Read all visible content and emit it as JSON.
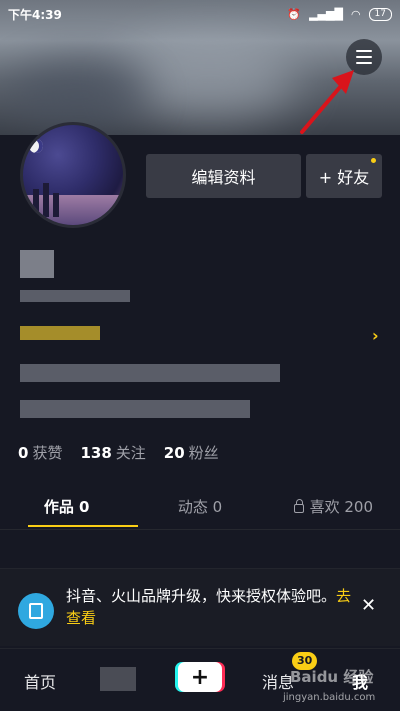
{
  "status_bar": {
    "time": "下午4:39",
    "battery": "17"
  },
  "profile": {
    "edit_button": "编辑资料",
    "add_friend_button": "+ 好友",
    "stats": [
      {
        "value": "0",
        "label": "获赞"
      },
      {
        "value": "138",
        "label": "关注"
      },
      {
        "value": "20",
        "label": "粉丝"
      }
    ]
  },
  "tabs": [
    {
      "label": "作品 0",
      "active": true
    },
    {
      "label": "动态 0",
      "active": false
    },
    {
      "label": "喜欢 200",
      "active": false,
      "icon": "lock-icon"
    }
  ],
  "notice": {
    "text": "抖音、火山品牌升级，快来授权体验吧。",
    "link": "去查看",
    "close": "✕"
  },
  "tab_bar": {
    "home": "首页",
    "plus": "+",
    "messages": "消息",
    "messages_badge": "30",
    "me": "我"
  },
  "watermark": {
    "logo": "Baidu 经验",
    "url": "jingyan.baidu.com"
  },
  "colors": {
    "accent": "#face15",
    "background": "#161823",
    "button": "#393b45",
    "notice_icon": "#2fa8e0"
  }
}
